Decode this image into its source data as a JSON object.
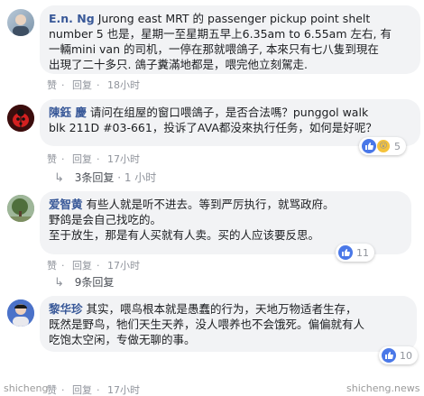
{
  "comments": [
    {
      "author": "E.n. Ng",
      "text": "Jurong east MRT 的 passenger pickup point 5 也是, number 5 也是，星期一至星期五早上6.35am to 6.55am 左右, 有一輛mini van 的司机，一停在那就喂鴿子, 本來只有七八隻到現在出現了二十多只. 鴿子糞滿地都是，喂完他立刻駕走.",
      "text_lines": [
        "Jurong east MRT 的 passenger pickup point shelt",
        "number 5 也是，星期一至星期五早上6.35am to 6.55am 左右, 有",
        "一輛mini van 的司机，一停在那就喂鴿子, 本來只有七八隻到現在",
        "出現了二十多只. 鴿子糞滿地都是，喂完他立刻駕走."
      ],
      "like_label": "赞",
      "reply_label": "回复",
      "time": "18小时"
    },
    {
      "author": "陳鈺 慶",
      "text_lines": [
        "请问在组屋的窗口喂鴿子，是否合法嗎？punggol walk",
        "blk 211D #03-661，投诉了AVA都没來执行任务，如何是好呢？"
      ],
      "like_label": "赞",
      "reply_label": "回复",
      "time": "17小时",
      "reactions": "5",
      "replies_text": "3条回复",
      "replies_time": "1 小时"
    },
    {
      "author": "爱智黄",
      "text_lines": [
        "有些人就是听不进去。等到严厉执行，就骂政府。",
        "野鸽是会自己找吃的。",
        "至于放生，那是有人买就有人卖。买的人应该要反思。"
      ],
      "like_label": "赞",
      "reply_label": "回复",
      "time": "17小时",
      "reactions": "11",
      "replies_text": "9条回复"
    },
    {
      "author": "黎华珍",
      "text_lines": [
        "其实，喂鸟根本就是愚蠢的行为，天地万物适者生存，",
        "既然是野鸟，牠们天生天养，没人喂养也不会饿死。偏偏就有人",
        "吃饱太空闲，专做无聊的事。"
      ],
      "like_label": "赞",
      "reply_label": "回复",
      "time": "17小时",
      "reactions": "10"
    }
  ],
  "watermarks": {
    "left": "shicheng",
    "right": "shicheng.news"
  }
}
